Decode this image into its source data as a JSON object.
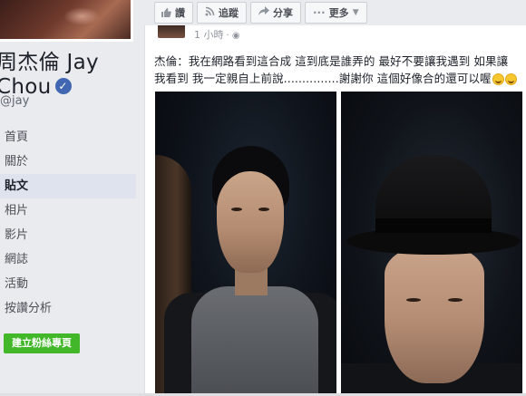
{
  "page": {
    "name_line1": "周杰倫 Jay",
    "name_line2": "Chou",
    "handle": "@jay",
    "verified_mark": "✓"
  },
  "sidebar": {
    "items": [
      {
        "label": "首頁",
        "active": false
      },
      {
        "label": "關於",
        "active": false
      },
      {
        "label": "貼文",
        "active": true
      },
      {
        "label": "相片",
        "active": false
      },
      {
        "label": "影片",
        "active": false
      },
      {
        "label": "網誌",
        "active": false
      },
      {
        "label": "活動",
        "active": false
      },
      {
        "label": "按讚分析",
        "active": false
      }
    ],
    "create_button": "建立粉絲專頁"
  },
  "actions": {
    "like": "讚",
    "follow": "追蹤",
    "share": "分享",
    "more": "更多"
  },
  "post": {
    "timestamp": "1 小時",
    "text_line1": "杰倫：我在網路看到這合成 這到底是誰弄的 最好不要讓我遇到 如果讓",
    "text_line2": "我看到 我一定親自上前說...............謝謝你 這個好像合的還可以喔",
    "emoji_count": 2
  },
  "colors": {
    "fb_blue": "#4267b2",
    "create_green": "#42b72a",
    "page_bg": "#e9ebee"
  },
  "icons": [
    "like-icon",
    "rss-icon",
    "share-icon",
    "more-dots-icon",
    "chevron-down-icon",
    "globe-icon",
    "verified-badge-icon"
  ]
}
